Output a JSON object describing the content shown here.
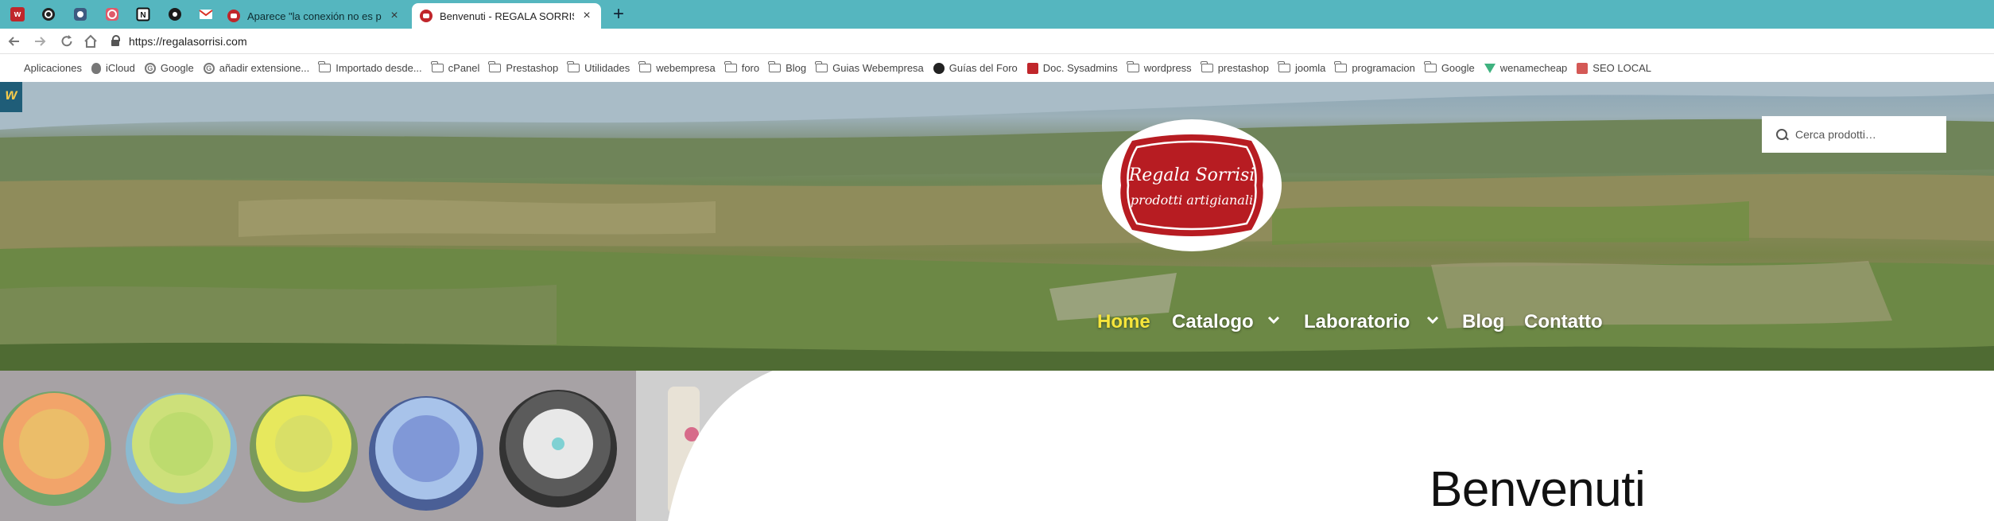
{
  "browser": {
    "pinned_tabs": [
      {
        "icon": "webempresa-icon"
      },
      {
        "icon": "wordpress-like-icon"
      },
      {
        "icon": "app-icon"
      },
      {
        "icon": "settings-app-icon"
      },
      {
        "icon": "notion-icon"
      },
      {
        "icon": "dark-circle-icon"
      },
      {
        "icon": "gmail-icon"
      }
    ],
    "tabs": [
      {
        "title": "Aparece \"la conexión no es pr",
        "active": false
      },
      {
        "title": "Benvenuti - REGALA SORRISI",
        "active": true
      }
    ],
    "new_tab_symbol": "+",
    "close_symbol": "×",
    "url": "https://regalasorrisi.com",
    "accent_color": "#55b6bf"
  },
  "bookmarks": [
    {
      "label": "Aplicaciones",
      "icon": "apps-grid-icon"
    },
    {
      "label": "iCloud",
      "icon": "apple-icon"
    },
    {
      "label": "Google",
      "icon": "google-icon"
    },
    {
      "label": "añadir extensione...",
      "icon": "google-icon"
    },
    {
      "label": "Importado desde...",
      "icon": "folder-icon"
    },
    {
      "label": "cPanel",
      "icon": "folder-icon"
    },
    {
      "label": "Prestashop",
      "icon": "folder-icon"
    },
    {
      "label": "Utilidades",
      "icon": "folder-icon"
    },
    {
      "label": "webempresa",
      "icon": "folder-icon"
    },
    {
      "label": "foro",
      "icon": "folder-icon"
    },
    {
      "label": "Blog",
      "icon": "folder-icon"
    },
    {
      "label": "Guias Webempresa",
      "icon": "folder-icon"
    },
    {
      "label": "Guías del Foro",
      "icon": "circle-icon"
    },
    {
      "label": "Doc. Sysadmins",
      "icon": "webempresa-icon"
    },
    {
      "label": "wordpress",
      "icon": "folder-icon"
    },
    {
      "label": "prestashop",
      "icon": "folder-icon"
    },
    {
      "label": "joomla",
      "icon": "folder-icon"
    },
    {
      "label": "programacion",
      "icon": "folder-icon"
    },
    {
      "label": "Google",
      "icon": "folder-icon"
    },
    {
      "label": "wenamecheap",
      "icon": "vue-icon"
    },
    {
      "label": "SEO LOCAL",
      "icon": "seo-icon"
    }
  ],
  "site": {
    "badge": "w",
    "logo": {
      "line1": "Regala Sorrisi",
      "line2": "prodotti artigianali",
      "color": "#b71c22"
    },
    "search_placeholder": "Cerca prodotti…",
    "nav": [
      {
        "label": "Home",
        "active": true
      },
      {
        "label": "Catalogo",
        "has_submenu": true
      },
      {
        "label": "Laboratorio",
        "has_submenu": true
      },
      {
        "label": "Blog"
      },
      {
        "label": "Contatto"
      }
    ],
    "nav_active_color": "#f7e53b",
    "heading": "Benvenuti"
  }
}
